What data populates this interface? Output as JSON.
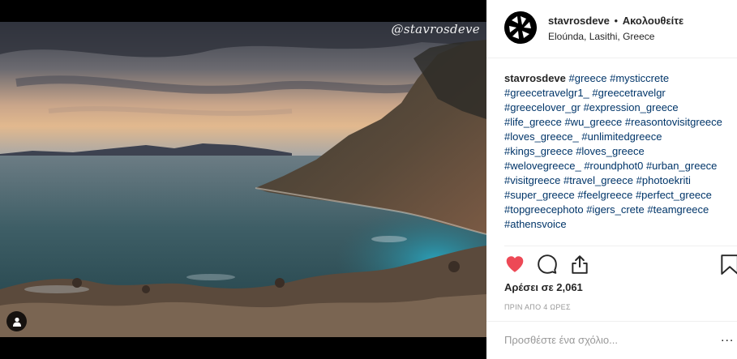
{
  "photo": {
    "watermark": "@stavrosdeve",
    "tag_icon": "person-icon"
  },
  "header": {
    "username": "stavrosdeve",
    "separator": "•",
    "follow_label": "Ακολουθείτε",
    "location": "Eloúnda, Lasithi, Greece",
    "avatar_icon": "camera-aperture-icon"
  },
  "caption": {
    "username": "stavrosdeve",
    "hashtags": [
      "#greece",
      "#mysticcrete",
      "#greecetravelgr1_",
      "#greecetravelgr",
      "#greecelover_gr",
      "#expression_greece",
      "#life_greece",
      "#wu_greece",
      "#reasontovisitgreece",
      "#loves_greece_",
      "#unlimitedgreece",
      "#kings_greece",
      "#loves_greece",
      "#welovegreece_",
      "#roundphot0",
      "#urban_greece",
      "#visitgreece",
      "#travel_greece",
      "#photoekriti",
      "#super_greece",
      "#feelgreece",
      "#perfect_greece",
      "#topgreecephoto",
      "#igers_crete",
      "#teamgreece",
      "#athensvoice"
    ]
  },
  "actions": {
    "like_icon": "heart-filled-icon",
    "comment_icon": "comment-icon",
    "share_icon": "share-icon",
    "save_icon": "bookmark-icon",
    "like_color": "#ed4956"
  },
  "likes_text": "Αρέσει σε 2,061",
  "time_ago": "ΠΡΙΝ ΑΠΟ 4 ΩΡΕΣ",
  "comment": {
    "placeholder": "Προσθέστε ένα σχόλιο...",
    "more_label": "..."
  }
}
